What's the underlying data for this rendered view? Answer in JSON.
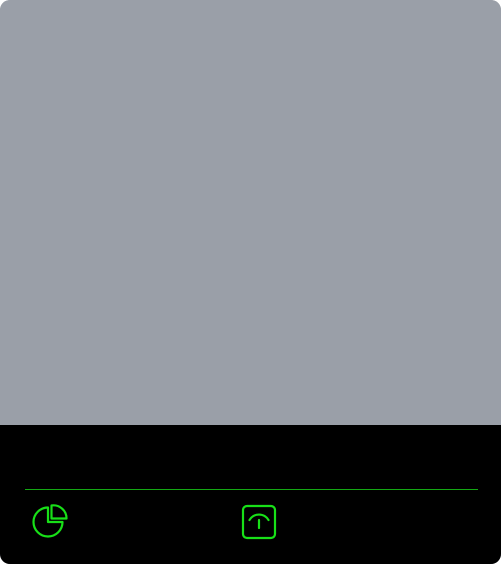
{
  "theme": {
    "content_background": "#9a9fa8",
    "bar_background": "#000000",
    "accent": "#18e018",
    "divider": "#13a813"
  },
  "tab_bar": {
    "tabs": [
      {
        "icon": "pie-chart-icon"
      },
      {
        "icon": "gauge-icon"
      }
    ]
  }
}
